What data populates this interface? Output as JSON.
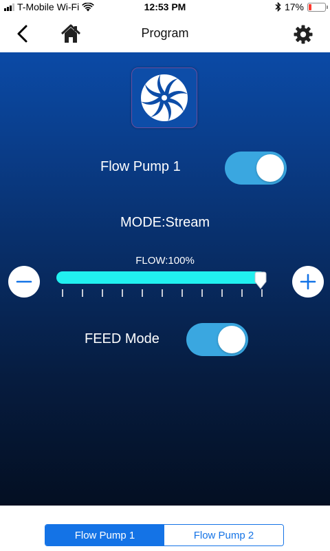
{
  "status_bar": {
    "carrier": "T-Mobile Wi-Fi",
    "time": "12:53 PM",
    "battery": "17%",
    "battery_level": 0.17,
    "icons": [
      "signal-icon",
      "wifi-icon",
      "bluetooth-icon",
      "battery-icon"
    ]
  },
  "nav": {
    "title": "Program",
    "back_icon": "chevron-left-icon",
    "home_icon": "home-icon",
    "settings_icon": "gear-icon"
  },
  "main": {
    "logo_icon": "swirl-logo-icon",
    "pump_label": "Flow Pump 1",
    "pump_on": true,
    "mode_text": "MODE:Stream",
    "flow_text": "FLOW:100%",
    "flow_value": 100,
    "minus_icon": "minus-icon",
    "plus_icon": "plus-icon",
    "feed_label": "FEED Mode",
    "feed_on": true
  },
  "segments": {
    "items": [
      {
        "label": "Flow Pump 1",
        "active": true
      },
      {
        "label": "Flow Pump 2",
        "active": false
      }
    ]
  },
  "colors": {
    "accent": "#1473e6",
    "toggle": "#3aa7e0",
    "slider_fill": "#21f0f0",
    "battery_low": "#ff3b30"
  }
}
